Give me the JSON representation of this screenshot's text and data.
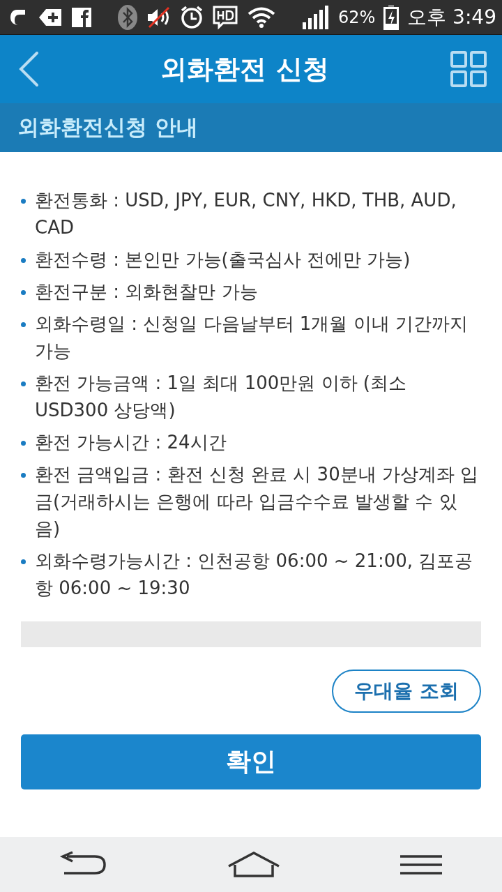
{
  "status_bar": {
    "battery_text": "62%",
    "time": "오후 3:49"
  },
  "header": {
    "title": "외화환전 신청"
  },
  "section": {
    "title": "외화환전신청 안내"
  },
  "info_items": [
    "환전통화 : USD, JPY, EUR, CNY, HKD, THB, AUD, CAD",
    "환전수령 : 본인만 가능(출국심사 전에만 가능)",
    "환전구분 : 외화현찰만 가능",
    "외화수령일 : 신청일 다음날부터 1개월 이내 기간까지 가능",
    "환전 가능금액 : 1일 최대 100만원 이하 (최소 USD300 상당액)",
    "환전 가능시간 : 24시간",
    "환전 금액입금 : 환전 신청 완료 시 30분내 가상계좌 입금(거래하시는 은행에 따라 입금수수료 발생할 수 있음)",
    "외화수령가능시간 : 인천공항 06:00 ~ 21:00, 김포공항 06:00 ~ 19:30"
  ],
  "rate_button": "우대율 조회",
  "confirm_button": "확인"
}
